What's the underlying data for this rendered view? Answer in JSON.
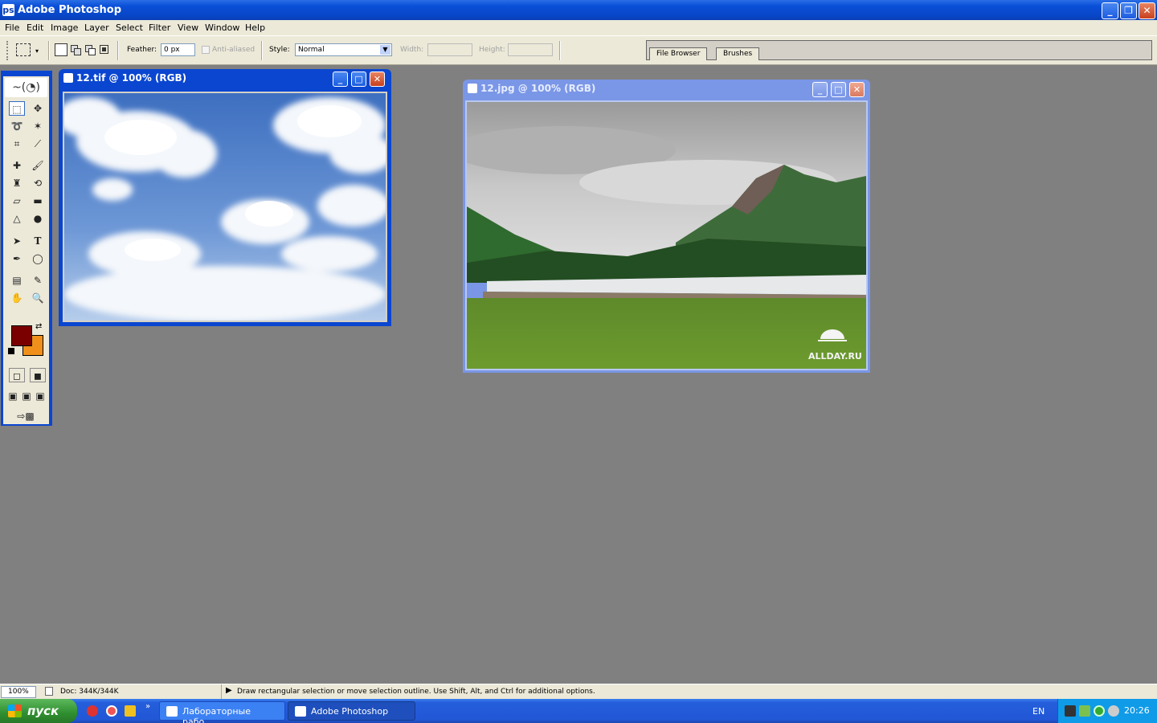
{
  "window": {
    "title": "Adobe Photoshop"
  },
  "menu": [
    "File",
    "Edit",
    "Image",
    "Layer",
    "Select",
    "Filter",
    "View",
    "Window",
    "Help"
  ],
  "options": {
    "feather_label": "Feather:",
    "feather_value": "0 px",
    "antialiased_label": "Anti-aliased",
    "style_label": "Style:",
    "style_value": "Normal",
    "width_label": "Width:",
    "height_label": "Height:"
  },
  "palette_well": {
    "tabs": [
      "File Browser",
      "Brushes"
    ]
  },
  "documents": [
    {
      "title": "12.tif @ 100% (RGB)",
      "active": true
    },
    {
      "title": "12.jpg @ 100% (RGB)",
      "active": false,
      "watermark": "ALLDAY.RU"
    }
  ],
  "colors": {
    "foreground": "#7a0000",
    "background": "#f0901a",
    "title_bar": "#0a46d0",
    "workspace": "#808080"
  },
  "status": {
    "zoom": "100%",
    "doc_info": "Doc: 344K/344K",
    "hint": "Draw rectangular selection or move selection outline.  Use Shift, Alt, and Ctrl for additional options."
  },
  "taskbar": {
    "start_label": "пуск",
    "tasks": [
      {
        "label": "Лабораторные рабо...",
        "active": false
      },
      {
        "label": "Adobe Photoshop",
        "active": true
      }
    ],
    "language": "EN",
    "clock": "20:26"
  }
}
